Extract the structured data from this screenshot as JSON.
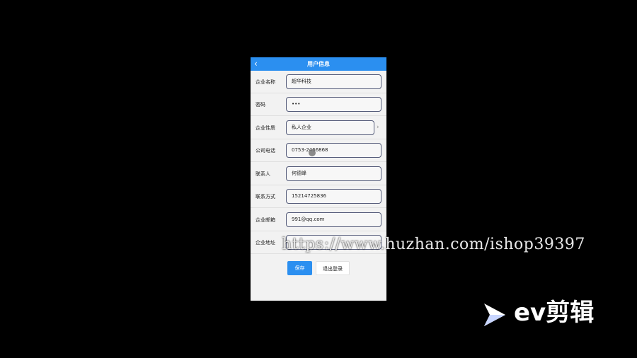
{
  "header": {
    "back_icon": "chevron-left-icon",
    "back_glyph": "‹",
    "title": "用户信息"
  },
  "form": [
    {
      "label": "企业名称",
      "value": "超华科技",
      "type": "text"
    },
    {
      "label": "密码",
      "value": "•••",
      "type": "password"
    },
    {
      "label": "企业性质",
      "value": "私人企业",
      "type": "select"
    },
    {
      "label": "公司电话",
      "value": "0753-2466868",
      "type": "text"
    },
    {
      "label": "联系人",
      "value": "何德峰",
      "type": "text"
    },
    {
      "label": "联系方式",
      "value": "15214725836",
      "type": "text"
    },
    {
      "label": "企业邮箱",
      "value": "991@qq.com",
      "type": "text"
    },
    {
      "label": "企业地址",
      "value": "",
      "type": "text"
    }
  ],
  "select_chevron": "›",
  "buttons": {
    "save": "保存",
    "logout": "退出登录"
  },
  "watermark": {
    "url": "https://www.huzhan.com/ishop39397",
    "brand": "ev剪辑"
  },
  "colors": {
    "accent": "#2b8ff0",
    "background": "#000000",
    "panel": "#f2f2f2"
  }
}
